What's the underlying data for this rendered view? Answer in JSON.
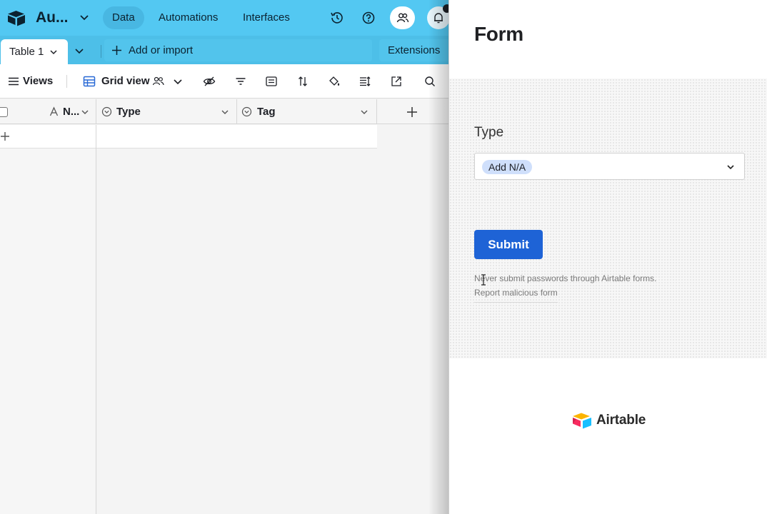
{
  "app": {
    "base_name": "Au...",
    "nav": [
      "Data",
      "Automations",
      "Interfaces"
    ],
    "active_nav": "Data"
  },
  "tabs": {
    "active": "Table 1",
    "add_or_import": "Add or import",
    "extensions": "Extensions"
  },
  "toolbar": {
    "views_label": "Views",
    "grid_view_label": "Grid view"
  },
  "grid": {
    "columns": [
      "N...",
      "Type",
      "Tag"
    ]
  },
  "form": {
    "title": "Form",
    "field_label": "Type",
    "selected_option": "Add N/A",
    "submit_label": "Submit",
    "notice": "Never submit passwords through Airtable forms.",
    "report_link": "Report malicious form",
    "brand": "Airtable"
  },
  "colors": {
    "topbar": "#53c8f2",
    "submit": "#1e63d6",
    "chip": "#cfdffb"
  }
}
